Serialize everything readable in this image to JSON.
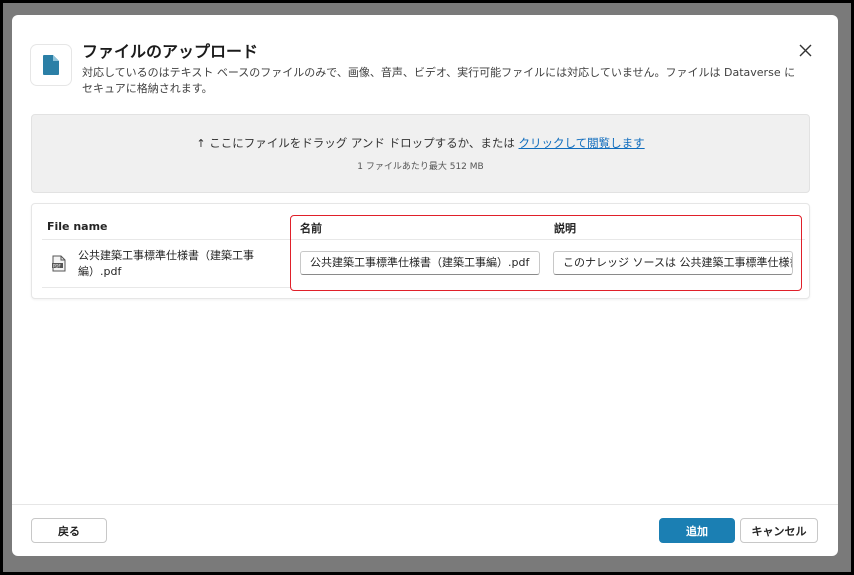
{
  "dialog": {
    "title": "ファイルのアップロード",
    "subtitle": "対応しているのはテキスト ベースのファイルのみで、画像、音声、ビデオ、実行可能ファイルには対応していません。ファイルは Dataverse にセキュアに格納されます。"
  },
  "dropzone": {
    "prefix": "ここにファイルをドラッグ アンド ドロップするか、または ",
    "link": "クリックして閲覧します",
    "note": "1 ファイルあたり最大 512 MB"
  },
  "table": {
    "headers": {
      "file_name": "File name",
      "name": "名前",
      "description": "説明"
    },
    "rows": [
      {
        "file_name": "公共建築工事標準仕様書（建築工事編）.pdf",
        "name_value": "公共建築工事標準仕様書（建築工事編）.pdf",
        "description_value": "このナレッジ ソースは 公共建築工事標準仕様書（建築工事編）"
      }
    ]
  },
  "footer": {
    "back": "戻る",
    "add": "追加",
    "cancel": "キャンセル"
  },
  "colors": {
    "primary": "#1b7fb3",
    "highlight": "#e0202a",
    "link": "#0f6cbd"
  },
  "icons": {
    "file": "document-icon",
    "close": "close-icon",
    "upload": "upload-arrow-icon",
    "pdf": "pdf-file-icon"
  }
}
